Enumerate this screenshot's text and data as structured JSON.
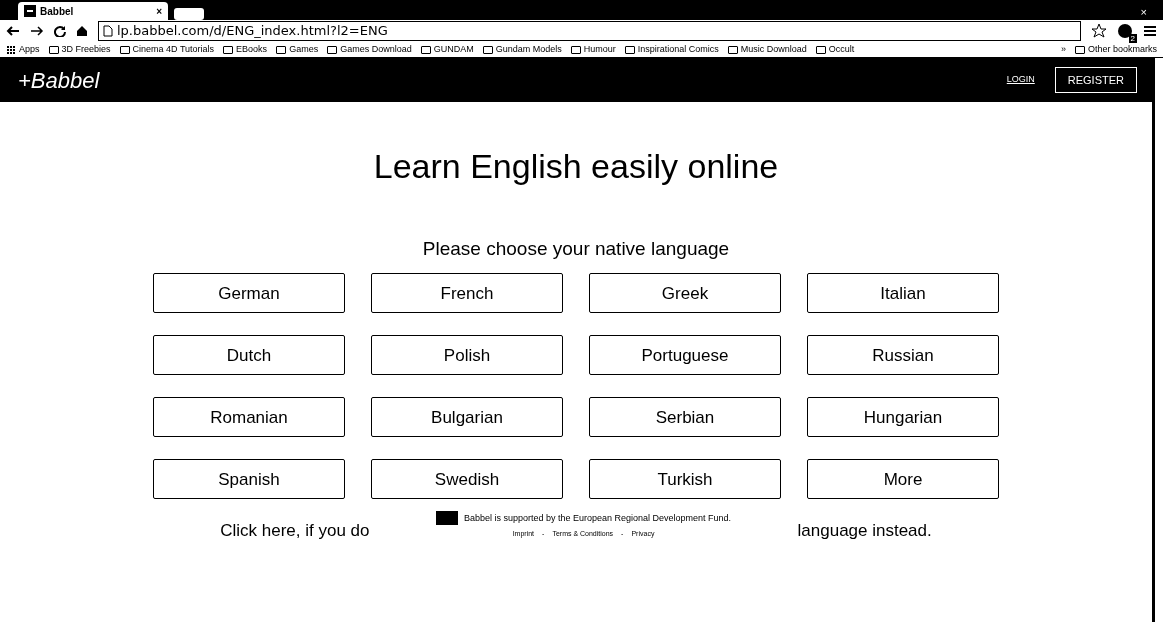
{
  "browser": {
    "tab_title": "Babbel",
    "tab_close": "×",
    "window_close": "×",
    "url": "lp.babbel.com/d/ENG_index.html?l2=ENG",
    "extension_badge": "2",
    "bookmarks": [
      "Apps",
      "3D Freebies",
      "Cinema 4D Tutorials",
      "EBooks",
      "Games",
      "Games Download",
      "GUNDAM",
      "Gundam Models",
      "Humour",
      "Inspirational Comics",
      "Music Download",
      "Occult"
    ],
    "bookmarks_overflow": "»",
    "other_bookmarks": "Other bookmarks"
  },
  "navbar": {
    "logo": "+Babbel",
    "login": "LOGIN",
    "register": "REGISTER"
  },
  "heading": "Learn English easily online",
  "subheading": "Please choose your native language",
  "languages": [
    "German",
    "French",
    "Greek",
    "Italian",
    "Dutch",
    "Polish",
    "Portuguese",
    "Russian",
    "Romanian",
    "Bulgarian",
    "Serbian",
    "Hungarian",
    "Spanish",
    "Swedish",
    "Turkish",
    "More"
  ],
  "footer": {
    "sentence_start": "Click here, if you do",
    "sentence_end": "language instead.",
    "support_note": "Babbel is supported by the European Regional Development Fund.",
    "links": [
      "Imprint",
      "Terms & Conditions",
      "Privacy"
    ],
    "separator": "-"
  }
}
